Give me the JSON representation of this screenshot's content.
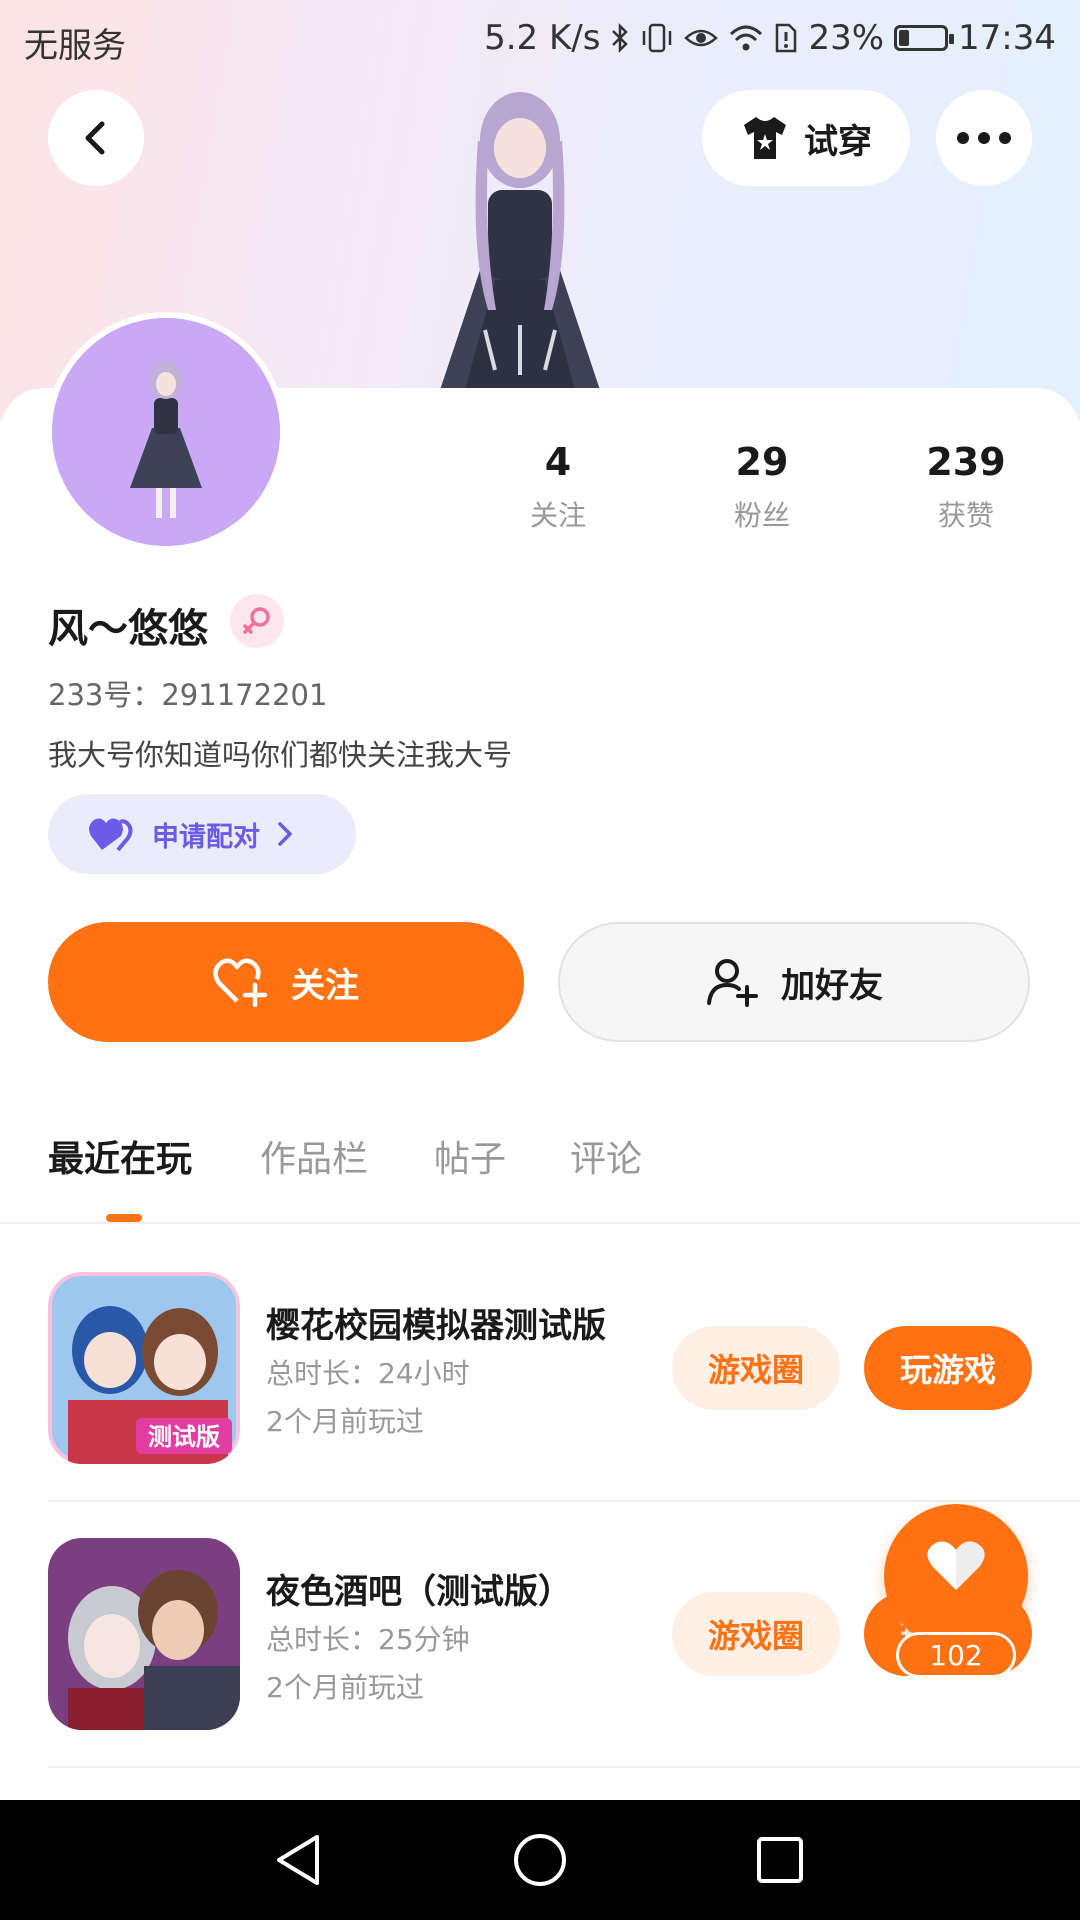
{
  "status_bar": {
    "carrier": "无服务",
    "speed": "5.2 K/s",
    "battery_percent": "23%",
    "battery_level": 0.23,
    "time": "17:34"
  },
  "header": {
    "tryon_label": "试穿"
  },
  "profile": {
    "stats": [
      {
        "value": "4",
        "label": "关注"
      },
      {
        "value": "29",
        "label": "粉丝"
      },
      {
        "value": "239",
        "label": "获赞"
      }
    ],
    "name": "风～悠悠",
    "uid": "233号：291172201",
    "bio": "我大号你知道吗你们都快关注我大号",
    "pair_label": "申请配对"
  },
  "actions": {
    "follow_label": "关注",
    "add_friend_label": "加好友"
  },
  "tabs": [
    {
      "label": "最近在玩",
      "active": true
    },
    {
      "label": "作品栏",
      "active": false
    },
    {
      "label": "帖子",
      "active": false
    },
    {
      "label": "评论",
      "active": false
    }
  ],
  "games": [
    {
      "title": "樱花校园模拟器测试版",
      "duration": "总时长：24小时",
      "last_played": "2个月前玩过",
      "circle_label": "游戏圈",
      "play_label": "玩游戏",
      "icon_badge": "测试版"
    },
    {
      "title": "夜色酒吧（测试版）",
      "duration": "总时长：25分钟",
      "last_played": "2个月前玩过",
      "circle_label": "游戏圈",
      "play_label": "玩游戏"
    }
  ],
  "floating_like": {
    "count": "102"
  },
  "colors": {
    "accent": "#ff7214",
    "pair_text": "#6b5ce7",
    "pair_bg": "#ecebfb"
  }
}
